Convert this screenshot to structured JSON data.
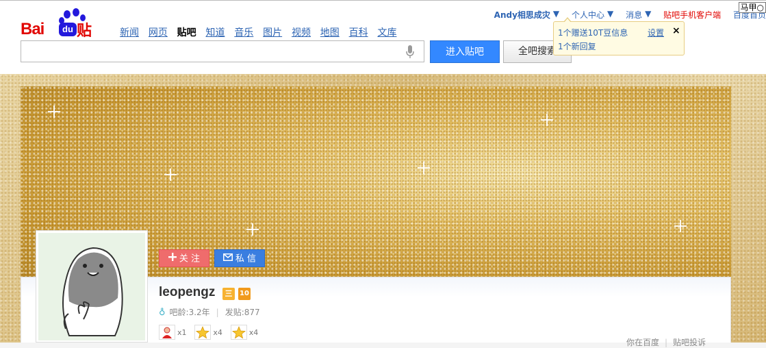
{
  "header": {
    "logo": {
      "bai": "Bai",
      "du": "du",
      "tieba": "贴吧"
    },
    "nav": [
      "新闻",
      "网页",
      "贴吧",
      "知道",
      "音乐",
      "图片",
      "视频",
      "地图",
      "百科",
      "文库"
    ],
    "search_placeholder": "",
    "enter_button": "进入贴吧",
    "all_search_button": "全吧搜索"
  },
  "userbar": {
    "username": "Andy相思成灾",
    "personal_center": "个人中心",
    "messages": "消息",
    "mobile_client": "贴吧手机客户端",
    "home": "百度首页",
    "majia": "马甲"
  },
  "notification": {
    "line1": "1个赠送10T豆信息",
    "line2": "1个新回复",
    "settings": "设置",
    "close": "×"
  },
  "profile": {
    "follow": "关 注",
    "message": "私 信",
    "name": "leopengz",
    "level_badge": "三",
    "vip_badge": "10",
    "age_label": "吧龄:3.2年",
    "posts_label": "发贴:877",
    "gifts": [
      {
        "icon": "person-gift-icon",
        "count": "x1"
      },
      {
        "icon": "star-gift-icon",
        "count": "x4"
      },
      {
        "icon": "star-gift-icon",
        "count": "x4"
      }
    ]
  },
  "bottom_links": [
    "你在百度",
    "贴吧投诉"
  ],
  "colors": {
    "brand_red": "#e10602",
    "link_blue": "#2d64b3",
    "button_blue": "#3388ff"
  }
}
